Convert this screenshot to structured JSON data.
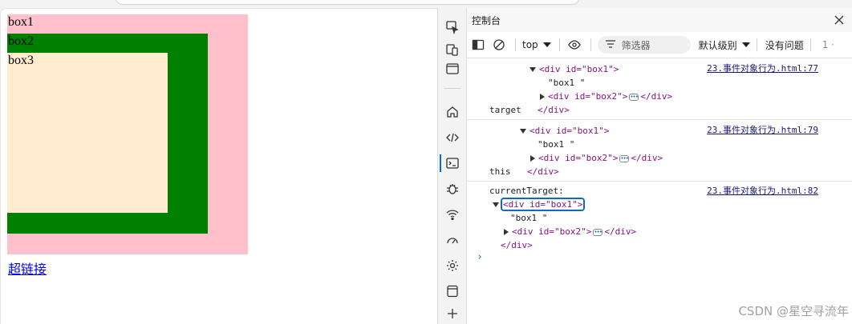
{
  "page": {
    "box1_label": "box1",
    "box2_label": "box2",
    "box3_label": "box3",
    "link_text": "超链接"
  },
  "devtools": {
    "panel_title": "控制台",
    "toolbar": {
      "context": "top",
      "filter_placeholder": "筛选器",
      "levels": "默认级别",
      "issues": "没有问题",
      "overflow": "1 ·"
    },
    "messages": [
      {
        "label": "target",
        "source": "23.事件对象行为.html:77",
        "open_tag": "<div id=\"box1\">",
        "text_node": "\"box1 \"",
        "child_tag_open": "<div id=\"box2\">",
        "child_tag_close": "</div>",
        "close_tag": "</div>"
      },
      {
        "label": "this",
        "source": "23.事件对象行为.html:79",
        "open_tag": "<div id=\"box1\">",
        "text_node": "\"box1 \"",
        "child_tag_open": "<div id=\"box2\">",
        "child_tag_close": "</div>",
        "close_tag": "</div>"
      },
      {
        "label": "currentTarget:",
        "source": "23.事件对象行为.html:82",
        "open_tag": "<div id=\"box1\">",
        "text_node": "\"box1 \"",
        "child_tag_open": "<div id=\"box2\">",
        "child_tag_close": "</div>",
        "close_tag": "</div>"
      }
    ],
    "prompt": "›"
  },
  "watermark": "CSDN @星空寻流年",
  "colors": {
    "box1": "#ffc0cb",
    "box2": "#008000",
    "box3": "#ffebcd",
    "link": "#0000ee",
    "accent": "#0f6cbd"
  }
}
